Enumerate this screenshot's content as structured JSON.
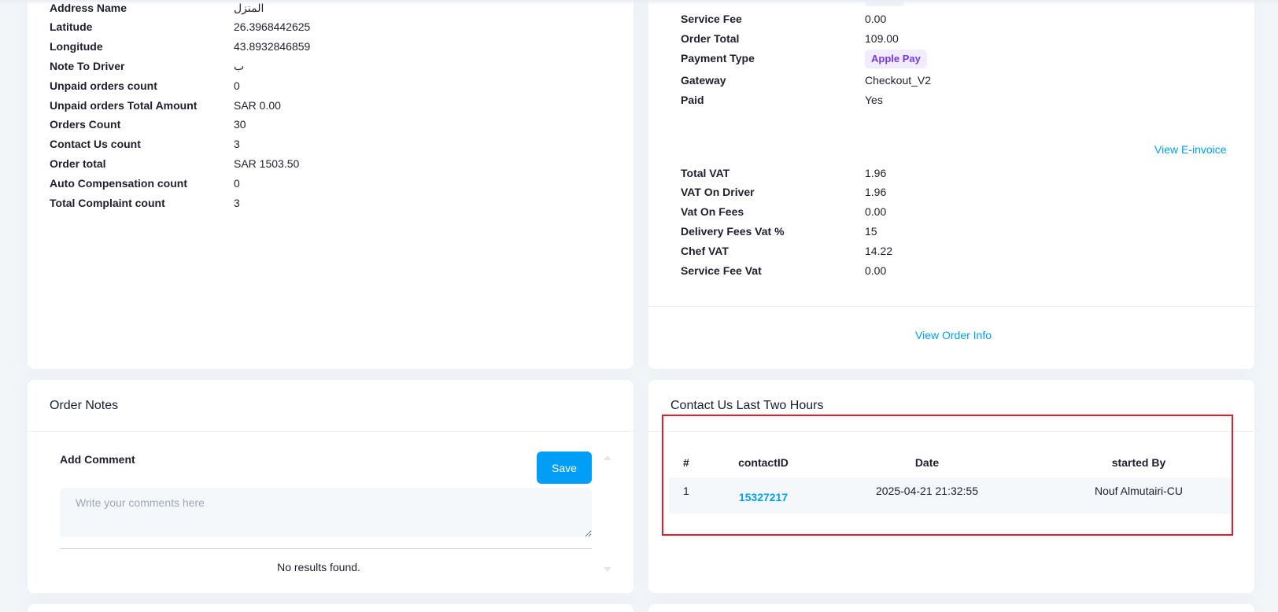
{
  "customer_info": {
    "rows": [
      {
        "label": "Address Name",
        "value": "المنزل"
      },
      {
        "label": "Latitude",
        "value": "26.3968442625"
      },
      {
        "label": "Longitude",
        "value": "43.8932846859"
      },
      {
        "label": "Note To Driver",
        "value": "ب"
      },
      {
        "label": "Unpaid orders count",
        "value": "0"
      },
      {
        "label": "Unpaid orders Total Amount",
        "value": "SAR 0.00"
      },
      {
        "label": "Orders Count",
        "value": "30"
      },
      {
        "label": "Contact Us count",
        "value": "3"
      },
      {
        "label": "Order total",
        "value": "SAR 1503.50"
      },
      {
        "label": "Auto Compensation count",
        "value": "0"
      },
      {
        "label": "Total Complaint count",
        "value": "3"
      }
    ]
  },
  "payment_info": {
    "rows": [
      {
        "label": "Service Fee",
        "value": "0.00"
      },
      {
        "label": "Order Total",
        "value": "109.00"
      },
      {
        "label": "Payment Type",
        "value": "Apple Pay"
      },
      {
        "label": "Gateway",
        "value": "Checkout_V2"
      },
      {
        "label": "Paid",
        "value": "Yes"
      }
    ],
    "view_einvoice_label": "View E-invoice",
    "vat_rows": [
      {
        "label": "Total VAT",
        "value": "1.96"
      },
      {
        "label": "VAT On Driver",
        "value": "1.96"
      },
      {
        "label": "Vat On Fees",
        "value": "0.00"
      },
      {
        "label": "Delivery Fees Vat %",
        "value": "15"
      },
      {
        "label": "Chef VAT",
        "value": "14.22"
      },
      {
        "label": "Service Fee Vat",
        "value": "0.00"
      }
    ],
    "view_order_info_label": "View Order Info",
    "colors": {
      "apple_pay_badge_bg": "#f1ecff",
      "apple_pay_badge_text": "#7239ea",
      "link": "#009ef7"
    }
  },
  "order_notes": {
    "title": "Order Notes",
    "add_comment_label": "Add Comment",
    "save_label": "Save",
    "comment_placeholder": "Write your comments here",
    "empty_text": "No results found."
  },
  "contact_us": {
    "title": "Contact Us Last Two Hours",
    "columns": [
      "#",
      "contactID",
      "Date",
      "started By"
    ],
    "rows": [
      {
        "num": "1",
        "contact_id": "15327217",
        "date": "2025-04-21 21:32:55",
        "started_by": "Nouf Almutairi-CU"
      }
    ],
    "highlight_color": "#e01e2e"
  }
}
